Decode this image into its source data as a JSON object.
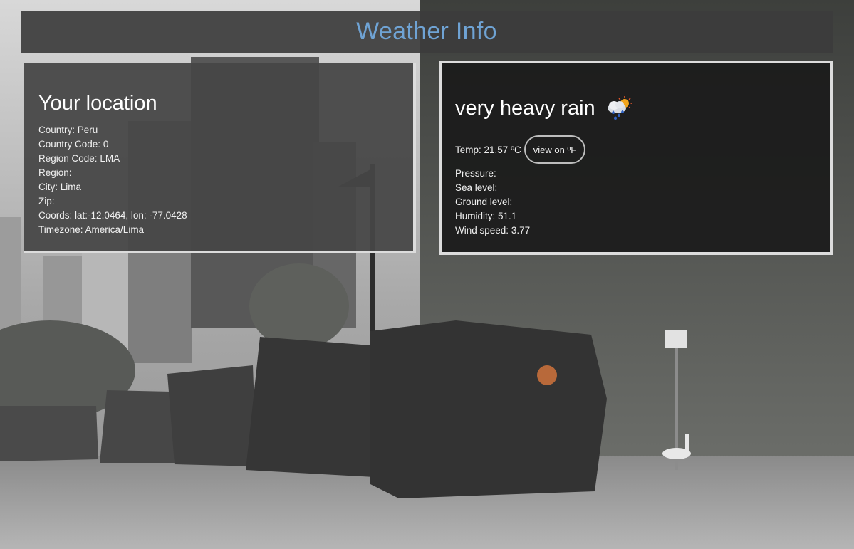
{
  "header": {
    "title": "Weather Info"
  },
  "location": {
    "heading": "Your location",
    "country_label": "Country:",
    "country": "Peru",
    "country_code_label": "Country Code:",
    "country_code": "0",
    "region_code_label": "Region Code:",
    "region_code": "LMA",
    "region_label": "Region:",
    "region": "",
    "city_label": "City:",
    "city": "Lima",
    "zip_label": "Zip:",
    "zip": "",
    "coords_label": "Coords:",
    "coords": "lat:-12.0464, lon: -77.0428",
    "timezone_label": "Timezone:",
    "timezone": "America/Lima"
  },
  "weather": {
    "description": "very heavy rain",
    "icon": "rain-cloud-sun-icon",
    "temp_label": "Temp:",
    "temp": "21.57 ºC",
    "unit_toggle_label": "view on ºF",
    "pressure_label": "Pressure:",
    "pressure": "",
    "sea_level_label": "Sea level:",
    "sea_level": "",
    "ground_level_label": "Ground level:",
    "ground_level": "",
    "humidity_label": "Humidity:",
    "humidity": "51.1",
    "wind_speed_label": "Wind speed:",
    "wind_speed": "3.77"
  },
  "colors": {
    "title_accent": "#6fa3d4",
    "panel_border": "#dcdcdc"
  }
}
